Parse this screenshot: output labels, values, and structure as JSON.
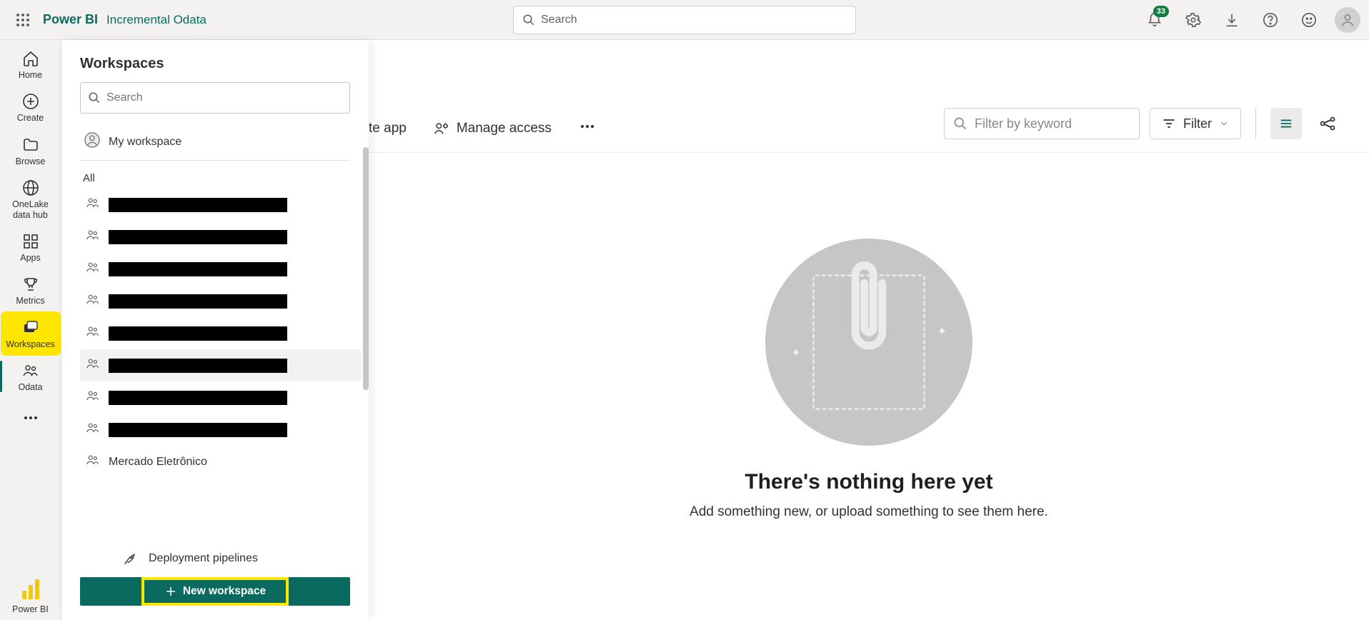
{
  "brand": "Power BI",
  "subtitle": "Incremental Odata",
  "search_placeholder": "Search",
  "notifications_count": "33",
  "nav": {
    "home": "Home",
    "create": "Create",
    "browse": "Browse",
    "onelake": "OneLake data hub",
    "apps": "Apps",
    "metrics": "Metrics",
    "workspaces": "Workspaces",
    "odata": "Odata",
    "powerbi": "Power BI"
  },
  "flyout": {
    "title": "Workspaces",
    "search_placeholder": "Search",
    "my_workspace": "My workspace",
    "all_label": "All",
    "named_item": "Mercado Eletrônico",
    "pipelines": "Deployment pipelines",
    "new_workspace": "New workspace"
  },
  "toolbar": {
    "create_app_suffix": "te app",
    "manage_access": "Manage access",
    "filter_placeholder": "Filter by keyword",
    "filter_button": "Filter"
  },
  "empty": {
    "title": "There's nothing here yet",
    "subtitle": "Add something new, or upload something to see them here."
  }
}
